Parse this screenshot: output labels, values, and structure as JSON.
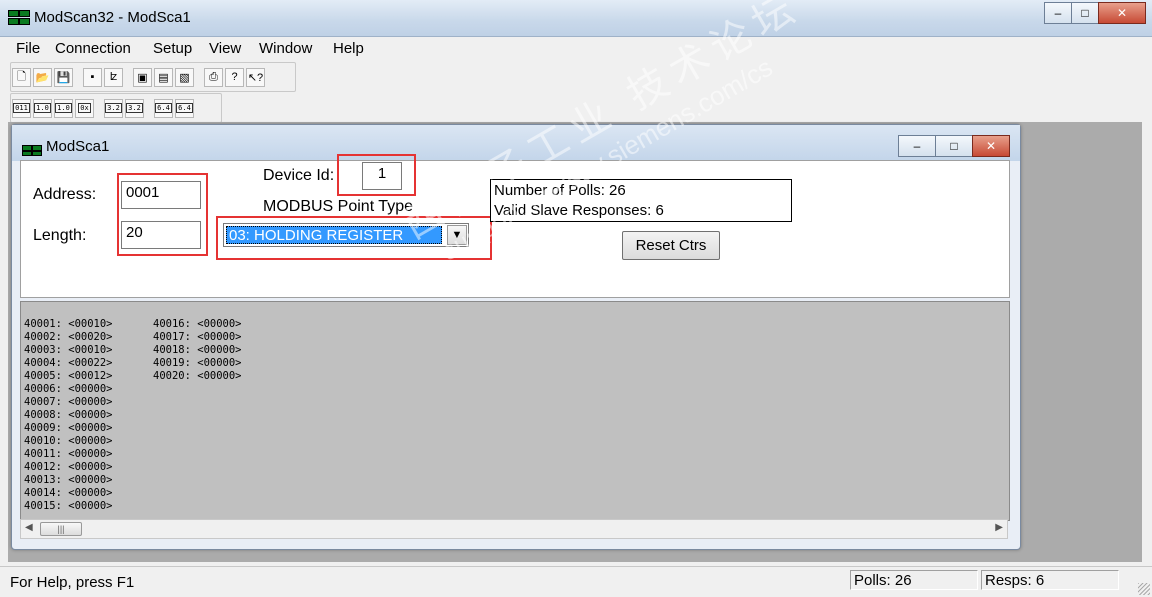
{
  "window": {
    "title": "ModScan32 - ModSca1"
  },
  "menu": [
    "File",
    "Connection",
    "Setup",
    "View",
    "Window",
    "Help"
  ],
  "toolbar2_tags": [
    "011",
    "1.0",
    "1.0",
    "0x",
    "3.2",
    "3.2",
    "6.4",
    "6.4"
  ],
  "child": {
    "title": "ModSca1"
  },
  "form": {
    "address_label": "Address:",
    "address_value": "0001",
    "length_label": "Length:",
    "length_value": "20",
    "device_id_label": "Device Id:",
    "device_id_value": "1",
    "point_type_label": "MODBUS Point Type",
    "point_type_value": "03: HOLDING REGISTER",
    "polls_line": "Number of Polls: 26",
    "responses_line": "Valid Slave Responses: 6",
    "reset_label": "Reset Ctrs"
  },
  "registers_col1": [
    "40001: <00010>",
    "40002: <00020>",
    "40003: <00010>",
    "40004: <00022>",
    "40005: <00012>",
    "40006: <00000>",
    "40007: <00000>",
    "40008: <00000>",
    "40009: <00000>",
    "40010: <00000>",
    "40011: <00000>",
    "40012: <00000>",
    "40013: <00000>",
    "40014: <00000>",
    "40015: <00000>"
  ],
  "registers_col2": [
    "40016: <00000>",
    "40017: <00000>",
    "40018: <00000>",
    "40019: <00000>",
    "40020: <00000>"
  ],
  "watermark": {
    "line1": "西门子工业 技术论坛",
    "line2": "support.industry.siemens.com/cs"
  },
  "status": {
    "help": "For Help, press F1",
    "polls": "Polls: 26",
    "resps": "Resps: 6"
  }
}
